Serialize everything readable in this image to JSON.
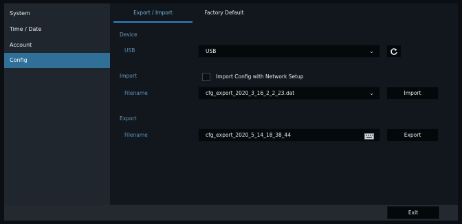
{
  "sidebar": {
    "items": [
      {
        "label": "System"
      },
      {
        "label": "Time / Date"
      },
      {
        "label": "Account"
      },
      {
        "label": "Config"
      }
    ]
  },
  "tabs": [
    {
      "label": "Export / Import"
    },
    {
      "label": "Factory Default"
    }
  ],
  "device": {
    "section_title": "Device",
    "usb_label": "USB",
    "usb_value": "USB"
  },
  "import": {
    "section_title": "Import",
    "checkbox_label": "Import Config with Network Setup",
    "checkbox_checked": false,
    "filename_label": "Filename",
    "filename_value": "cfg_export_2020_3_16_2_2_23.dat",
    "button_label": "Import"
  },
  "export": {
    "section_title": "Export",
    "filename_label": "Filename",
    "filename_value": "cfg_export_2020_5_14_18_38_44",
    "button_label": "Export"
  },
  "footer": {
    "exit_label": "Exit"
  },
  "icons": [
    "chevron-down-icon",
    "refresh-icon",
    "keyboard-icon"
  ],
  "colors": {
    "accent": "#2f86c4",
    "active_sidebar": "#2f6f98"
  }
}
